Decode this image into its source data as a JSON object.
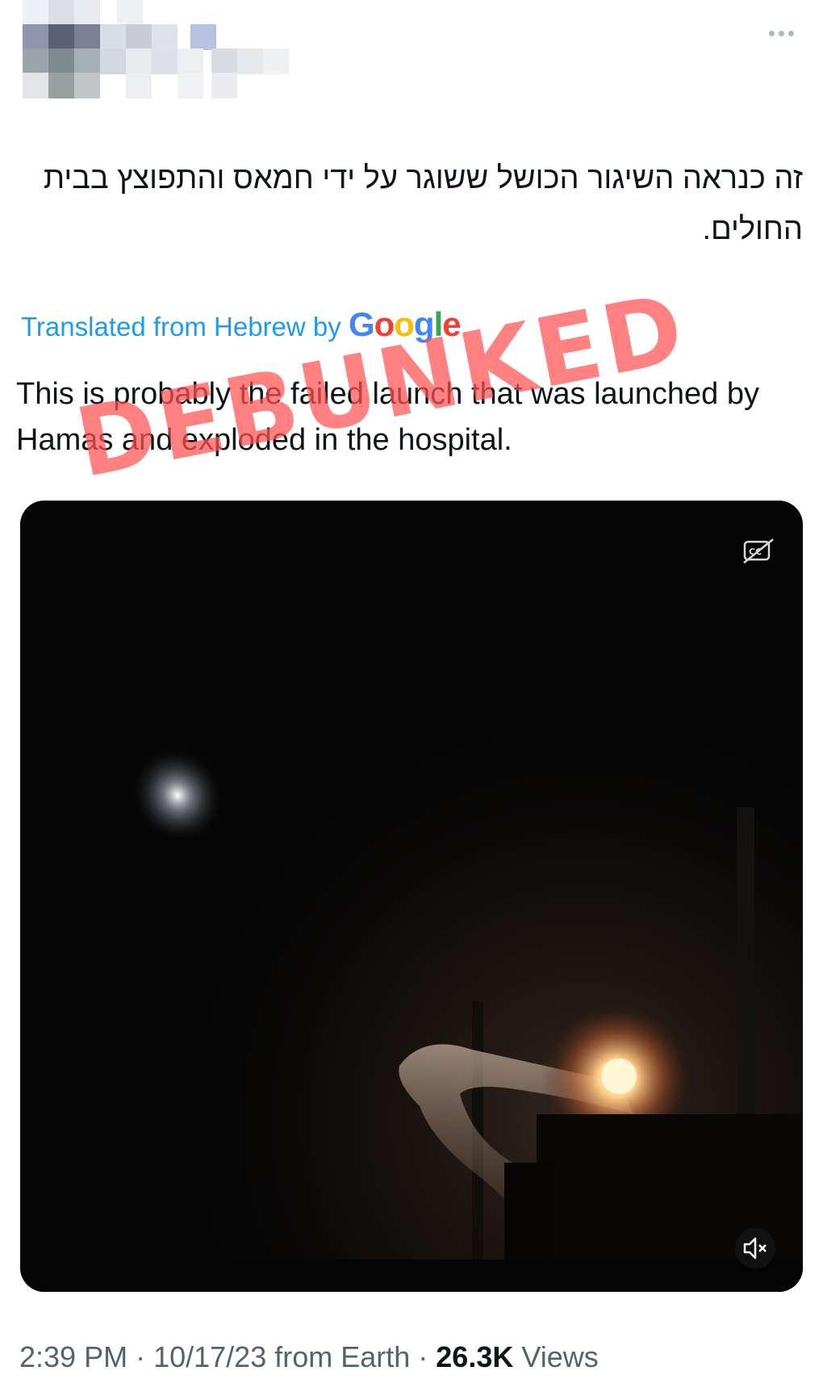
{
  "post": {
    "original_text": "זה כנראה השיגור הכושל ששוגר על ידי חמאס והתפוצץ בבית החולים.",
    "translation_label": "Translated from Hebrew by",
    "translation_brand": "Google",
    "translated_text": "This is probably the failed launch that was launched by Hamas and exploded in the hospital.",
    "stamp": "DEBUNKED",
    "meta": {
      "time": "2:39 PM",
      "separator1": " · ",
      "date": "10/17/23",
      "source": " from Earth",
      "separator2": " · ",
      "views_count": "26.3K",
      "views_label": " Views"
    }
  },
  "video": {
    "controls": {
      "captions_icon": "captions-off-icon",
      "mute_icon": "muted-speaker-icon"
    }
  },
  "colors": {
    "link_blue": "#1d9bf0",
    "stamp_red": "#ff5050",
    "meta_gray": "#536471",
    "google_blue": "#4285f4",
    "google_red": "#ea4335",
    "google_yellow": "#fbbc05",
    "google_green": "#34a853"
  }
}
